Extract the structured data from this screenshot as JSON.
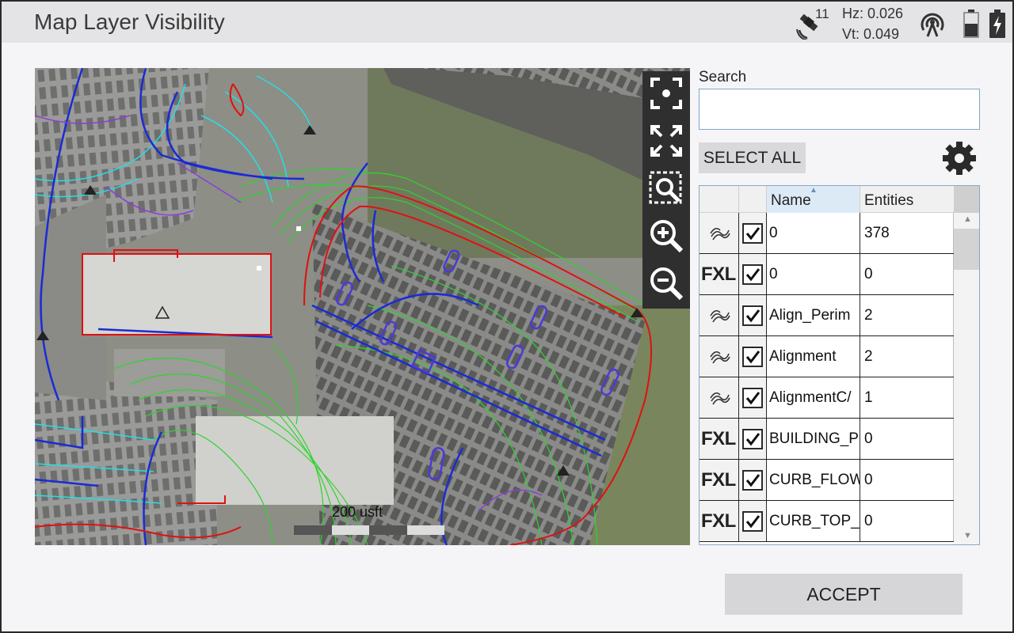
{
  "header": {
    "title": "Map Layer Visibility",
    "satellite_icon": "satellite-icon",
    "satellite_count": "11",
    "hz": "Hz: 0.026",
    "vt": "Vt: 0.049",
    "radio_icon": "radio-signal-icon",
    "battery_icon": "battery-icon",
    "charging_icon": "charging-bolt-icon"
  },
  "map": {
    "scale_label": "200 usft",
    "tools": [
      {
        "name": "center-location-icon"
      },
      {
        "name": "zoom-extents-icon"
      },
      {
        "name": "zoom-window-icon"
      },
      {
        "name": "zoom-in-icon"
      },
      {
        "name": "zoom-out-icon"
      }
    ]
  },
  "panel": {
    "search_label": "Search",
    "search_value": "",
    "search_placeholder": "",
    "select_all_label": "SELECT ALL",
    "settings_icon": "gear-icon"
  },
  "table": {
    "columns": [
      "Name",
      "Entities"
    ],
    "sorted_column": "Name",
    "rows": [
      {
        "type": "alignment",
        "type_icon": "alignment-line-icon",
        "checked": true,
        "name": "0",
        "entities": "378"
      },
      {
        "type": "FXL",
        "checked": true,
        "name": "0",
        "entities": "0"
      },
      {
        "type": "alignment",
        "type_icon": "alignment-line-icon",
        "checked": true,
        "name": "Align_Perim",
        "entities": "2"
      },
      {
        "type": "alignment",
        "type_icon": "alignment-line-icon",
        "checked": true,
        "name": "Alignment",
        "entities": "2"
      },
      {
        "type": "alignment",
        "type_icon": "alignment-line-icon",
        "checked": true,
        "name": "AlignmentC/",
        "entities": "1"
      },
      {
        "type": "FXL",
        "checked": true,
        "name": "BUILDING_P",
        "entities": "0"
      },
      {
        "type": "FXL",
        "checked": true,
        "name": "CURB_FLOW",
        "entities": "0"
      },
      {
        "type": "FXL",
        "checked": true,
        "name": "CURB_TOP_",
        "entities": "0"
      }
    ]
  },
  "footer": {
    "accept_label": "ACCEPT"
  },
  "colors": {
    "title_bar": "#e4e4e6",
    "map_toolbar": "#2f2f2f",
    "linework_green": "#2fd42f",
    "linework_blue": "#1a2bd6",
    "linework_cyan": "#22e0e6",
    "linework_red": "#e01010",
    "linework_purple": "#8a3fd8"
  }
}
